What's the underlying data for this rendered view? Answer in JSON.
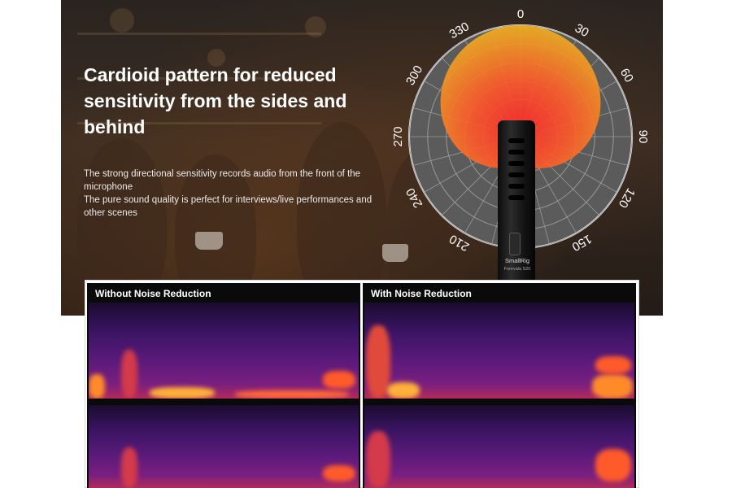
{
  "hero": {
    "headline": "Cardioid pattern for reduced sensitivity from the sides and behind",
    "description_lines": [
      "The strong directional sensitivity records audio from the front of the microphone",
      "The pure sound quality is perfect for interviews/live performances and other scenes"
    ]
  },
  "polar_chart": {
    "pattern": "cardioid",
    "angle_labels": [
      "0",
      "30",
      "60",
      "90",
      "120",
      "150",
      "210",
      "240",
      "270",
      "300",
      "330"
    ],
    "colors": {
      "inner": "#ff3b2b",
      "outer": "#f0b020",
      "grid": "#9a9a9a",
      "disc": "#5a5a5a"
    }
  },
  "microphone": {
    "brand": "SmallRig",
    "model": "Forevala S20"
  },
  "spectrograms": {
    "left_title": "Without Noise Reduction",
    "right_title": "With Noise Reduction",
    "colormap": [
      "#1a0b2e",
      "#5a1a7a",
      "#b22a5a",
      "#ff7a2a",
      "#ffe070"
    ]
  }
}
